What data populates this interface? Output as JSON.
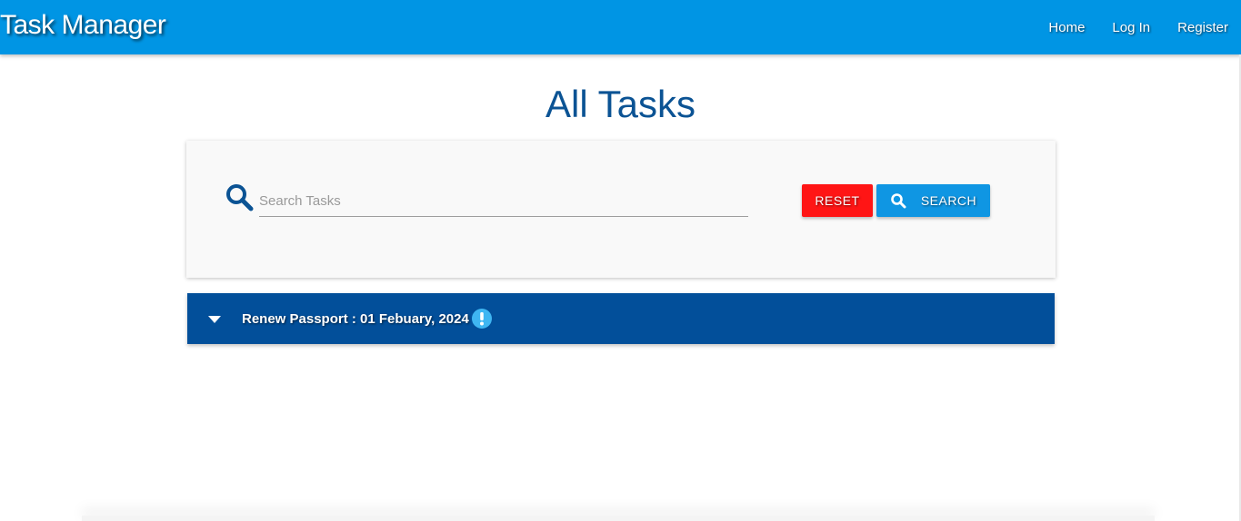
{
  "navbar": {
    "brand": "Task Manager",
    "links": [
      "Home",
      "Log In",
      "Register"
    ],
    "color": "#0095e4"
  },
  "main": {
    "title": "All Tasks",
    "search": {
      "placeholder": "Search Tasks",
      "value": "",
      "reset_label": "RESET",
      "search_label": "SEARCH",
      "reset_color": "#ff1515",
      "search_color": "#0f96e3"
    },
    "tasks": [
      {
        "label": "Renew Passport : 01 Febuary, 2024",
        "status_icon": "exclamation-circle-icon",
        "row_color": "#024f9a"
      }
    ]
  }
}
